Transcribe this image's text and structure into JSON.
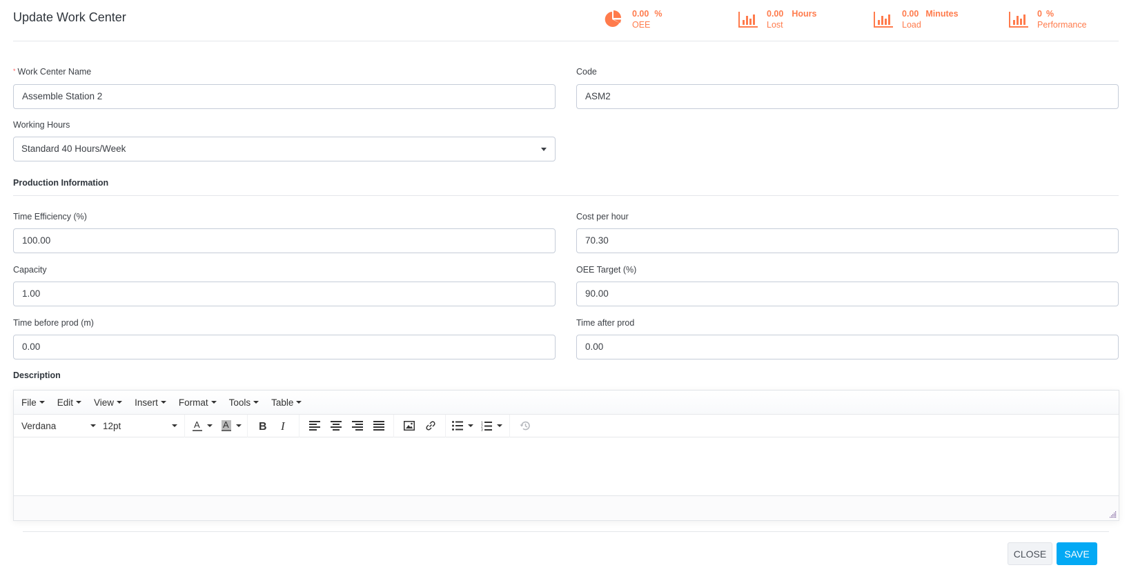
{
  "header": {
    "title": "Update Work Center",
    "kpis": [
      {
        "icon": "pie-chart-icon",
        "value": "0.00",
        "unit": "%",
        "label": "OEE"
      },
      {
        "icon": "bar-chart-icon",
        "value": "0.00",
        "unit": "Hours",
        "label": "Lost"
      },
      {
        "icon": "bar-chart-icon",
        "value": "0.00",
        "unit": "Minutes",
        "label": "Load"
      },
      {
        "icon": "bar-chart-icon",
        "value": "0",
        "unit": "%",
        "label": "Performance"
      }
    ],
    "accent_color": "#ff7b4c"
  },
  "form": {
    "work_center_name": {
      "label": "Work Center Name",
      "required": "*",
      "value": "Assemble Station 2"
    },
    "code": {
      "label": "Code",
      "value": "ASM2"
    },
    "working_hours": {
      "label": "Working Hours",
      "value": "Standard 40 Hours/Week"
    },
    "production_section": "Production Information",
    "time_efficiency": {
      "label": "Time Efficiency (%)",
      "value": "100.00"
    },
    "cost_per_hour": {
      "label": "Cost per hour",
      "value": "70.30"
    },
    "capacity": {
      "label": "Capacity",
      "value": "1.00"
    },
    "oee_target": {
      "label": "OEE Target (%)",
      "value": "90.00"
    },
    "time_before_prod": {
      "label": "Time before prod (m)",
      "value": "0.00"
    },
    "time_after_prod": {
      "label": "Time after prod",
      "value": "0.00"
    },
    "description": {
      "label": "Description",
      "value": ""
    }
  },
  "editor": {
    "menus": [
      "File",
      "Edit",
      "View",
      "Insert",
      "Format",
      "Tools",
      "Table"
    ],
    "font_family": "Verdana",
    "font_size": "12pt"
  },
  "actions": {
    "close_label": "CLOSE",
    "save_label": "SAVE",
    "save_color": "#03a9f4"
  }
}
